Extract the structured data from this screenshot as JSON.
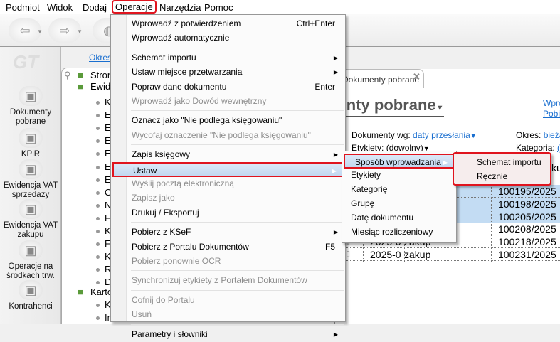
{
  "menubar": [
    "Podmiot",
    "Widok",
    "Dodaj",
    "Operacje",
    "Narzędzia",
    "Pomoc"
  ],
  "menubar_active": "Operacje",
  "accent": "#e0141e",
  "toolbar": {
    "buttons": [
      "back-arrow-icon",
      "forward-arrow-icon",
      "disk-icon"
    ]
  },
  "leftnav": [
    {
      "label": "Dokumenty pobrane",
      "icon": "download-tray-icon"
    },
    {
      "label": "KPiR",
      "icon": "book-icon"
    },
    {
      "label": "Ewidencja VAT sprzedaży",
      "icon": "coins-icon"
    },
    {
      "label": "Ewidencja VAT zakupu",
      "icon": "documents-icon"
    },
    {
      "label": "Operacje na środkach trw.",
      "icon": "cabinet-icon"
    },
    {
      "label": "Kontrahenci",
      "icon": "person-icon"
    }
  ],
  "logo": "GT",
  "okres_link": "Okres",
  "tree": {
    "items": [
      "Stron",
      "Ewide"
    ],
    "bullets": [
      "K",
      "E",
      "E",
      "E",
      "E",
      "E",
      "E",
      "O",
      "N",
      "F",
      "K",
      "F",
      "K",
      "R",
      "D"
    ],
    "group2": "Karto",
    "bullets2": [
      "K",
      "In"
    ]
  },
  "tab": {
    "label": "Dokumenty pobrane"
  },
  "content": {
    "title": "Dokumenty pobrane",
    "links": [
      "Wpro",
      "Pobie"
    ],
    "doc_by_label": "Dokumenty wg:",
    "doc_by_value": "daty przesłania",
    "period_label": "Okres:",
    "period_value": "bieżą",
    "labels_label": "Etykiety:",
    "labels_value": "(dowolny)",
    "category_label": "Kategoria:",
    "category_value": "(d",
    "header_fragment": "ku"
  },
  "table": {
    "rows": [
      {
        "date": "",
        "type": "",
        "number": "100195/2025",
        "selected": true
      },
      {
        "date": "",
        "type": "",
        "number": "100198/2025",
        "selected": true
      },
      {
        "date": "",
        "type": "",
        "number": "100205/2025",
        "selected": true
      },
      {
        "date": "",
        "type": "",
        "number": "100208/2025",
        "selected": false
      },
      {
        "date": "2025-0",
        "type": "zakup",
        "number": "100218/2025",
        "selected": false
      },
      {
        "date": "2025-0",
        "type": "zakup",
        "number": "100231/2025",
        "selected": false
      }
    ]
  },
  "operacje_menu": [
    {
      "label": "Wprowadź z potwierdzeniem",
      "shortcut": "Ctrl+Enter"
    },
    {
      "label": "Wprowadź automatycznie"
    },
    {
      "sep": true
    },
    {
      "label": "Schemat importu",
      "submenu": true
    },
    {
      "label": "Ustaw miejsce przetwarzania",
      "submenu": true
    },
    {
      "label": "Popraw dane dokumentu",
      "shortcut": "Enter"
    },
    {
      "label": "Wprowadź jako Dowód wewnętrzny",
      "disabled": true
    },
    {
      "sep": true
    },
    {
      "label": "Oznacz jako \"Nie podlega księgowaniu\""
    },
    {
      "label": "Wycofaj oznaczenie \"Nie podlega księgowaniu\"",
      "disabled": true
    },
    {
      "sep": true
    },
    {
      "label": "Zapis księgowy",
      "submenu": true
    },
    {
      "label": "Ustaw",
      "submenu": true,
      "highlighted": true
    },
    {
      "label": "Wyślij pocztą elektroniczną",
      "disabled": true
    },
    {
      "label": "Zapisz jako",
      "disabled": true
    },
    {
      "label": "Drukuj / Eksportuj"
    },
    {
      "sep": true
    },
    {
      "label": "Pobierz z KSeF",
      "submenu": true
    },
    {
      "label": "Pobierz z Portalu Dokumentów",
      "shortcut": "F5"
    },
    {
      "label": "Pobierz ponownie OCR",
      "disabled": true
    },
    {
      "sep": true
    },
    {
      "label": "Synchronizuj etykiety z Portalem Dokumentów",
      "disabled": true
    },
    {
      "sep": true
    },
    {
      "label": "Cofnij do Portalu",
      "disabled": true
    },
    {
      "label": "Usuń",
      "disabled": true
    },
    {
      "sep": true
    },
    {
      "label": "Parametry i słowniki",
      "submenu": true
    }
  ],
  "ustaw_menu": [
    {
      "label": "Sposób wprowadzania",
      "submenu": true,
      "highlighted": true
    },
    {
      "label": "Etykiety"
    },
    {
      "label": "Kategorię"
    },
    {
      "label": "Grupę"
    },
    {
      "label": "Datę dokumentu"
    },
    {
      "label": "Miesiąc rozliczeniowy"
    }
  ],
  "sposob_menu": [
    {
      "label": "Schemat importu"
    },
    {
      "label": "Ręcznie"
    }
  ]
}
